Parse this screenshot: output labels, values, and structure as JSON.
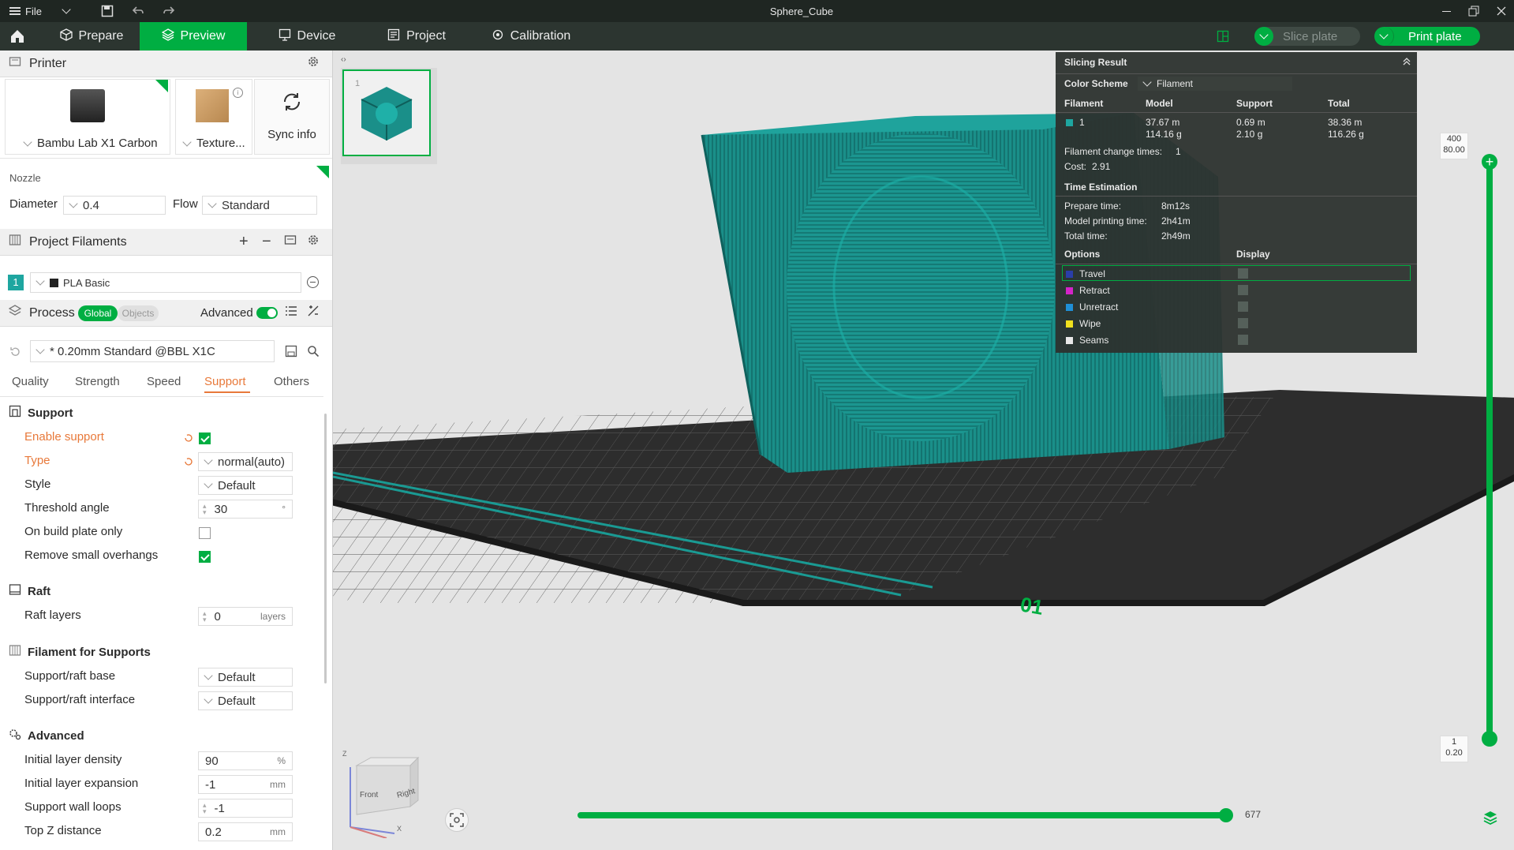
{
  "window": {
    "title": "Sphere_Cube",
    "file_menu": "File"
  },
  "tabs": [
    "Prepare",
    "Preview",
    "Device",
    "Project",
    "Calibration"
  ],
  "toolbar": {
    "slice_plate": "Slice plate",
    "print_plate": "Print plate"
  },
  "printer": {
    "header": "Printer",
    "name": "Bambu Lab X1 Carbon",
    "plate": "Texture...",
    "sync_info": "Sync info",
    "nozzle_label": "Nozzle",
    "diameter_label": "Diameter",
    "diameter_value": "0.4",
    "flow_label": "Flow",
    "flow_value": "Standard"
  },
  "filaments": {
    "header": "Project Filaments",
    "items": [
      {
        "index": "1",
        "name": "PLA Basic",
        "color": "#1ea6a0"
      }
    ]
  },
  "process": {
    "header": "Process",
    "global": "Global",
    "objects": "Objects",
    "advanced": "Advanced",
    "preset": "* 0.20mm Standard @BBL X1C",
    "subtabs": [
      "Quality",
      "Strength",
      "Speed",
      "Support",
      "Others"
    ],
    "active_subtab": "Support"
  },
  "support": {
    "title": "Support",
    "enable_label": "Enable support",
    "enable_checked": true,
    "type_label": "Type",
    "type_value": "normal(auto)",
    "style_label": "Style",
    "style_value": "Default",
    "threshold_label": "Threshold angle",
    "threshold_value": "30",
    "threshold_unit": "°",
    "buildplate_label": "On build plate only",
    "buildplate_checked": false,
    "overhangs_label": "Remove small overhangs",
    "overhangs_checked": true
  },
  "raft": {
    "title": "Raft",
    "layers_label": "Raft layers",
    "layers_value": "0",
    "layers_unit": "layers"
  },
  "filament_supports": {
    "title": "Filament for Supports",
    "base_label": "Support/raft base",
    "base_value": "Default",
    "interface_label": "Support/raft interface",
    "interface_value": "Default"
  },
  "advanced": {
    "title": "Advanced",
    "density_label": "Initial layer density",
    "density_value": "90",
    "density_unit": "%",
    "expansion_label": "Initial layer expansion",
    "expansion_value": "-1",
    "expansion_unit": "mm",
    "wall_loops_label": "Support wall loops",
    "wall_loops_value": "-1",
    "topz_label": "Top Z distance",
    "topz_value": "0.2",
    "topz_unit": "mm"
  },
  "plate_thumb": {
    "number": "1"
  },
  "viewcube": {
    "front": "Front",
    "right": "Right",
    "z": "Z",
    "x": "X"
  },
  "layer_slider": {
    "top_layer": "400",
    "top_height": "80.00",
    "bottom_layer": "1",
    "bottom_height": "0.20",
    "top_fraction": 1.0
  },
  "move_slider": {
    "value": "677",
    "fraction": 1.0
  },
  "plate_label": "01",
  "slicing_result": {
    "title": "Slicing Result",
    "color_scheme_label": "Color Scheme",
    "color_scheme_value": "Filament",
    "columns": [
      "Filament",
      "Model",
      "Support",
      "Total"
    ],
    "row": {
      "filament": "1",
      "model_len": "37.67 m",
      "model_weight": "114.16 g",
      "support_len": "0.69 m",
      "support_weight": "2.10 g",
      "total_len": "38.36 m",
      "total_weight": "116.26 g"
    },
    "change_times_label": "Filament change times:",
    "change_times_value": "1",
    "cost_label": "Cost:",
    "cost_value": "2.91",
    "time_title": "Time Estimation",
    "prepare_label": "Prepare time:",
    "prepare_value": "8m12s",
    "model_time_label": "Model printing time:",
    "model_time_value": "2h41m",
    "total_time_label": "Total time:",
    "total_time_value": "2h49m",
    "options_label": "Options",
    "display_label": "Display",
    "options": [
      {
        "name": "Travel",
        "color": "#2a3ea8"
      },
      {
        "name": "Retract",
        "color": "#d424c8"
      },
      {
        "name": "Unretract",
        "color": "#1f8fd6"
      },
      {
        "name": "Wipe",
        "color": "#f0e01e"
      },
      {
        "name": "Seams",
        "color": "#e8e8e8"
      }
    ]
  },
  "colors": {
    "accent": "#00ae42",
    "filament": "#1ea6a0",
    "label_modified": "#e8793a"
  }
}
